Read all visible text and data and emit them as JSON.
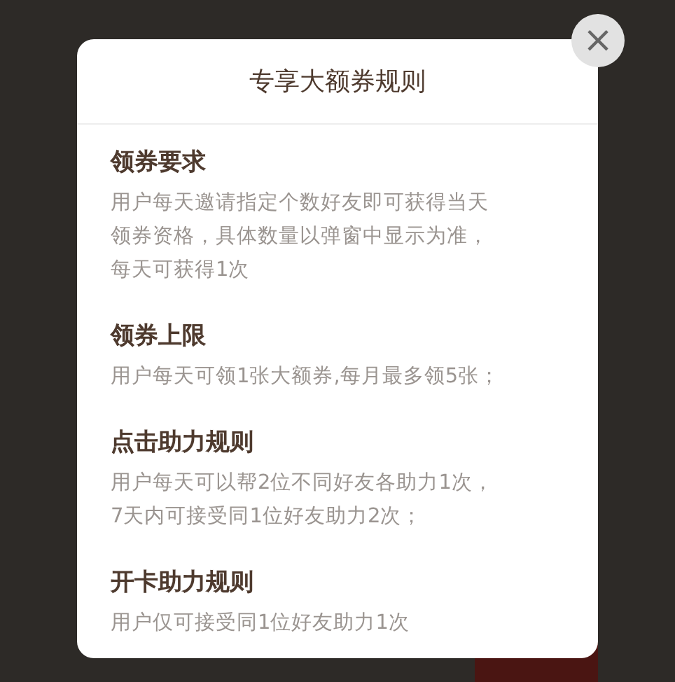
{
  "dialog": {
    "title": "专享大额券规则",
    "close": "×",
    "sections": [
      {
        "heading": "领券要求",
        "body": [
          "用户每天邀请指定个数好友即可获得当天",
          "领券资格，具体数量以弹窗中显示为准，",
          "每天可获得1次"
        ]
      },
      {
        "heading": "领券上限",
        "body": [
          "用户每天可领1张大额券,每月最多领5张；"
        ]
      },
      {
        "heading": "点击助力规则",
        "body": [
          "用户每天可以帮2位不同好友各助力1次，",
          "7天内可接受同1位好友助力2次；"
        ]
      },
      {
        "heading": "开卡助力规则",
        "body": [
          "用户仅可接受同1位好友助力1次"
        ]
      }
    ]
  }
}
